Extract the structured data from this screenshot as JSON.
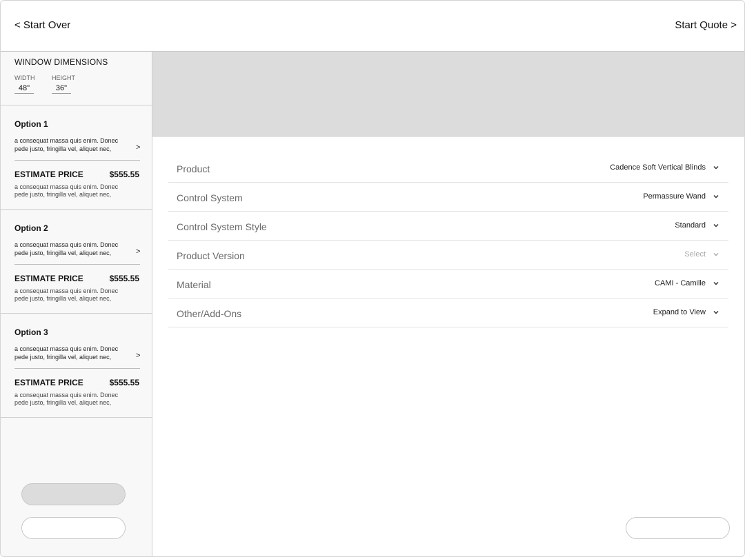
{
  "header": {
    "back_label": "< Start Over",
    "next_label": "Start Quote >"
  },
  "dimensions": {
    "title": "WINDOW DIMENSIONS",
    "width_label": "WIDTH",
    "width_value": "48\"",
    "height_label": "HEIGHT",
    "height_value": "36\""
  },
  "options": [
    {
      "title": "Option 1",
      "description": "a consequat massa quis enim. Donec pede justo, fringilla vel, aliquet nec,",
      "price_label": "ESTIMATE PRICE",
      "price": "$555.55",
      "note": "a consequat massa quis enim. Donec pede justo, fringilla vel, aliquet nec,"
    },
    {
      "title": "Option 2",
      "description": "a consequat massa quis enim. Donec pede justo, fringilla vel, aliquet nec,",
      "price_label": "ESTIMATE PRICE",
      "price": "$555.55",
      "note": "a consequat massa quis enim. Donec pede justo, fringilla vel, aliquet nec,"
    },
    {
      "title": "Option 3",
      "description": "a consequat massa quis enim. Donec pede justo, fringilla vel, aliquet nec,",
      "price_label": "ESTIMATE PRICE",
      "price": "$555.55",
      "note": "a consequat massa quis enim. Donec pede justo, fringilla vel, aliquet nec,"
    }
  ],
  "configurator": {
    "rows": [
      {
        "label": "Product",
        "value": "Cadence Soft Vertical Blinds",
        "placeholder": false
      },
      {
        "label": "Control System",
        "value": "Permassure Wand",
        "placeholder": false
      },
      {
        "label": "Control System Style",
        "value": "Standard",
        "placeholder": false
      },
      {
        "label": "Product Version",
        "value": "Select",
        "placeholder": true
      },
      {
        "label": "Material",
        "value": "CAMI - Camille",
        "placeholder": false
      },
      {
        "label": "Other/Add-Ons",
        "value": "Expand to View",
        "placeholder": false
      }
    ]
  },
  "icons": {
    "option_chevron": "chevron-right-icon",
    "row_chevron": "chevron-down-icon"
  },
  "colors": {
    "banner": "#dcdcdc",
    "sidebar_bg": "#f8f8f8",
    "pill_gray": "#dcdcdc",
    "row_label": "#6a6a6a",
    "placeholder_value": "#a8a8a8"
  }
}
